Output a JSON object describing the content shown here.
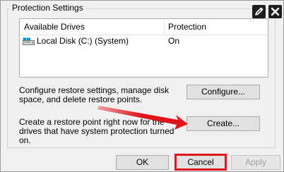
{
  "group": {
    "title": "Protection Settings"
  },
  "table": {
    "columns": [
      "Available Drives",
      "Protection"
    ],
    "rows": [
      {
        "drive": "Local Disk (C:) (System)",
        "protection": "On",
        "icon": "hard-drive-icon"
      }
    ]
  },
  "configure": {
    "description": "Configure restore settings, manage disk space, and delete restore points.",
    "button_label": "Configure..."
  },
  "create": {
    "description": "Create a restore point right now for the drives that have system protection turned on.",
    "button_label": "Create..."
  },
  "footer": {
    "ok_label": "OK",
    "cancel_label": "Cancel",
    "apply_label": "Apply"
  },
  "icons": {
    "edit": "pencil-icon",
    "close": "close-icon"
  },
  "annotation_color": "#e0141c"
}
